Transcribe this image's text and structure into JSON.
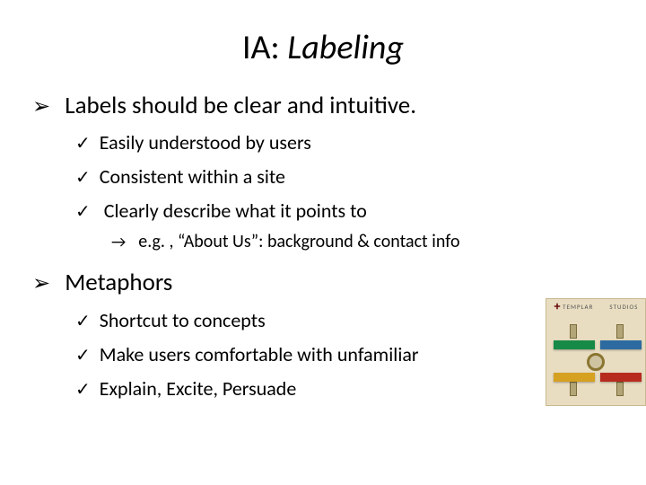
{
  "title_plain": "IA: ",
  "title_italic": "Labeling",
  "bullets": {
    "b1": "Labels should be clear and intuitive.",
    "b1_1": "Easily understood by users",
    "b1_2": "Consistent within a site",
    "b1_3": "Clearly describe what it points to",
    "b1_3_1": "e.g. , “About Us”: background & contact info",
    "b2": "Metaphors",
    "b2_1": "Shortcut to concepts",
    "b2_2": "Make users comfortable with unfamiliar",
    "b2_3": "Explain, Excite, Persuade"
  },
  "illus": {
    "logo_left": "TEMPLAR",
    "logo_right": "STUDIOS"
  }
}
